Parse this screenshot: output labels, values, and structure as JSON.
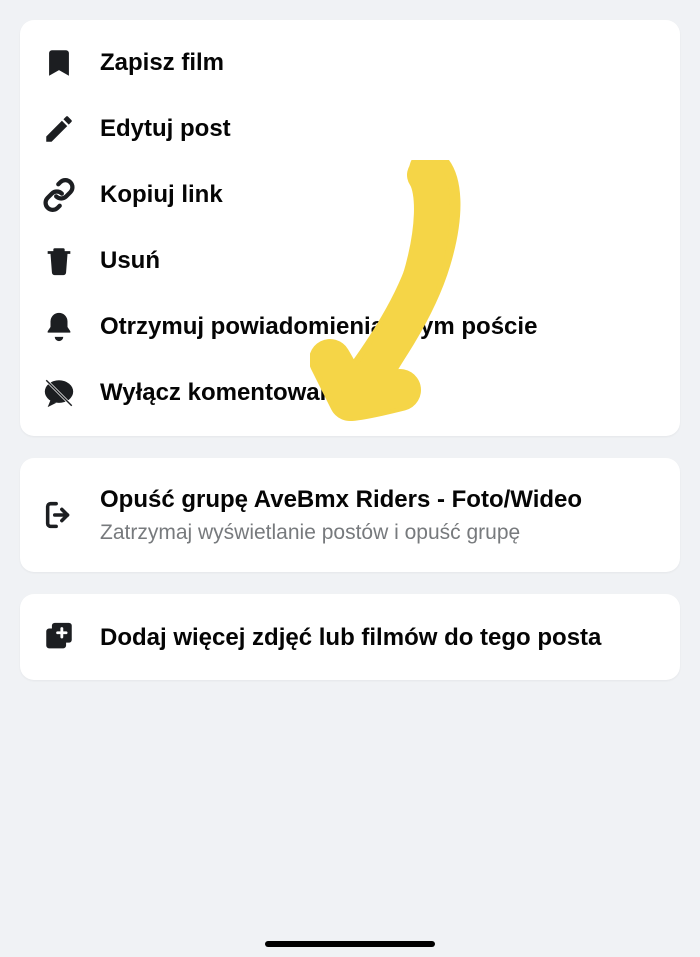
{
  "group1": {
    "items": [
      {
        "label": "Zapisz film"
      },
      {
        "label": "Edytuj post"
      },
      {
        "label": "Kopiuj link"
      },
      {
        "label": "Usuń"
      },
      {
        "label": "Otrzymuj powiadomienia o tym poście"
      },
      {
        "label": "Wyłącz komentowanie"
      }
    ]
  },
  "group2": {
    "items": [
      {
        "label": "Opuść grupę AveBmx Riders - Foto/Wideo",
        "sublabel": "Zatrzymaj wyświetlanie postów i opuść grupę"
      }
    ]
  },
  "group3": {
    "items": [
      {
        "label": "Dodaj więcej zdjęć lub filmów do tego posta"
      }
    ]
  }
}
